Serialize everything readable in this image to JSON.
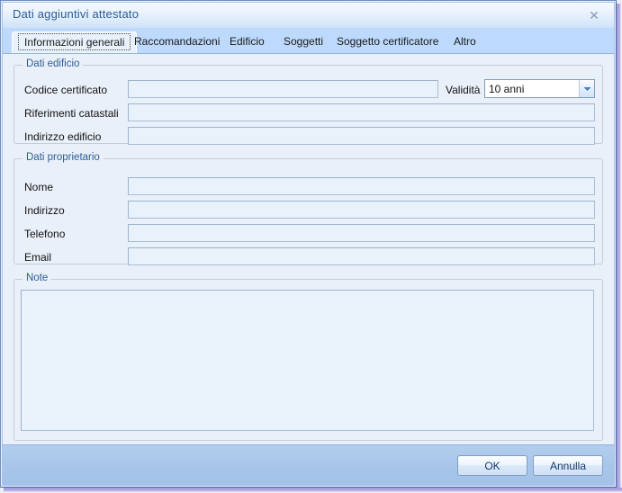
{
  "window": {
    "title": "Dati aggiuntivi attestato",
    "close_label": "✕",
    "close_icon": "close-icon"
  },
  "tabs": [
    {
      "label": "Informazioni generali",
      "active": true
    },
    {
      "label": "Raccomandazioni",
      "active": false
    },
    {
      "label": "Edificio",
      "active": false
    },
    {
      "label": "Soggetti",
      "active": false
    },
    {
      "label": "Soggetto certificatore",
      "active": false
    },
    {
      "label": "Altro",
      "active": false
    }
  ],
  "groups": {
    "edificio": {
      "legend": "Dati edificio",
      "fields": {
        "codice_certificato": {
          "label": "Codice certificato",
          "value": "",
          "placeholder": ""
        },
        "riferimenti_catastali": {
          "label": "Riferimenti catastali",
          "value": "",
          "placeholder": ""
        },
        "indirizzo_edificio": {
          "label": "Indirizzo edificio",
          "value": "",
          "placeholder": ""
        }
      },
      "validita": {
        "label": "Validità",
        "selected": "10 anni",
        "options": [
          "10 anni"
        ],
        "arrow_icon": "chevron-down-icon"
      }
    },
    "proprietario": {
      "legend": "Dati proprietario",
      "fields": {
        "nome": {
          "label": "Nome",
          "value": "",
          "placeholder": ""
        },
        "indirizzo": {
          "label": "Indirizzo",
          "value": "",
          "placeholder": ""
        },
        "telefono": {
          "label": "Telefono",
          "value": "",
          "placeholder": ""
        },
        "email": {
          "label": "Email",
          "value": "",
          "placeholder": ""
        }
      }
    },
    "note": {
      "legend": "Note",
      "value": "",
      "placeholder": ""
    }
  },
  "footer": {
    "ok_label": "OK",
    "cancel_label": "Annulla"
  },
  "colors": {
    "title_text": "#2c5c96",
    "tabstrip_bg": "#bdd9fb",
    "content_bg": "#eaf0fa",
    "footer_bg": "#a8c6e9",
    "field_bg": "#e9f1fb",
    "field_border": "#a9bed4",
    "legend_text": "#2c5c96",
    "shadow": "#9e96d8"
  }
}
